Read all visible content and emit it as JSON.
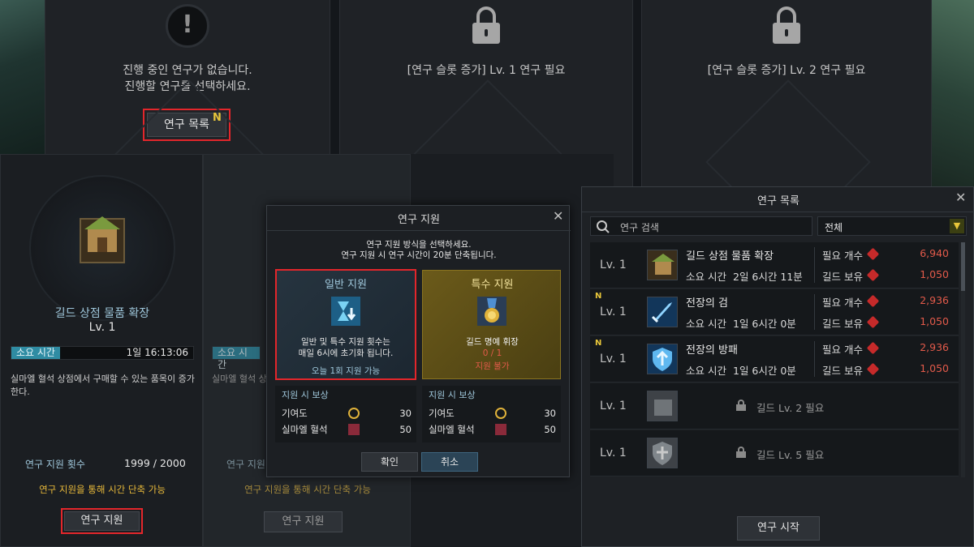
{
  "top_slots": {
    "slot1": {
      "line1": "진행 중인 연구가 없습니다.",
      "line2": "진행할 연구를 선택하세요.",
      "button": "연구 목록",
      "badge": "N"
    },
    "slot2": {
      "text": "[연구 슬롯 증가] Lv. 1 연구 필요"
    },
    "slot3": {
      "text": "[연구 슬롯 증가] Lv. 2 연구 필요"
    }
  },
  "research_panel": {
    "name": "길드 상점 물품 확장",
    "level": "Lv. 1",
    "time_label": "소요 시간",
    "time_value": "1일 16:13:06",
    "description": "실마엘 혈석 상점에서 구매할 수 있는 품목이 증가한다.",
    "support_count_label": "연구 지원 횟수",
    "support_count_value": "1999 / 2000",
    "notice": "연구 지원을 통해 시간 단축 가능",
    "button": "연구 지원"
  },
  "ghost_panel": {
    "time_label": "소요 시간",
    "description_fragment": "실마엘 혈석 상점",
    "support_count_label": "연구 지원 횟수",
    "notice": "연구 지원을 통해 시간 단축 가능",
    "button": "연구 지원"
  },
  "support_dialog": {
    "title": "연구 지원",
    "intro1": "연구 지원 방식을 선택하세요.",
    "intro2": "연구 지원 시 연구 시간이 20분 단축됩니다.",
    "normal": {
      "title": "일반 지원",
      "desc1": "일반 및 특수 지원 횟수는",
      "desc2": "매일 6시에 초기화 됩니다.",
      "available": "오늘 1회 지원 가능"
    },
    "special": {
      "title": "특수 지원",
      "item": "길드 명예 휘장",
      "count": "0 / 1",
      "status": "지원 불가"
    },
    "reward_header": "지원 시 보상",
    "rewards_normal": [
      {
        "label": "기여도",
        "value": "30"
      },
      {
        "label": "실마엘 혈석",
        "value": "50"
      }
    ],
    "rewards_special": [
      {
        "label": "기여도",
        "value": "30"
      },
      {
        "label": "실마엘 혈석",
        "value": "50"
      }
    ],
    "confirm": "확인",
    "cancel": "취소"
  },
  "research_list": {
    "title": "연구 목록",
    "search_placeholder": "연구 검색",
    "filter": "전체",
    "req_label": "필요 개수",
    "own_label": "길드 보유",
    "time_label": "소요 시간",
    "rows": [
      {
        "new": "",
        "lv": "Lv. 1",
        "name": "길드 상점 물품 확장",
        "time": "2일 6시간 11분",
        "req": "6,940",
        "own": "1,050"
      },
      {
        "new": "N",
        "lv": "Lv. 1",
        "name": "전장의 검",
        "time": "1일 6시간 0분",
        "req": "2,936",
        "own": "1,050"
      },
      {
        "new": "N",
        "lv": "Lv. 1",
        "name": "전장의 방패",
        "time": "1일 6시간 0분",
        "req": "2,936",
        "own": "1,050"
      },
      {
        "new": "",
        "lv": "Lv. 1",
        "locked": "길드 Lv. 2 필요"
      },
      {
        "new": "",
        "lv": "Lv. 1",
        "locked": "길드 Lv. 5 필요"
      }
    ],
    "start_button": "연구 시작"
  },
  "colors": {
    "highlight_red": "#e3262b",
    "cost_red": "#e25a4a",
    "notice_yellow": "#e8b93a",
    "time_label_teal": "#2f8ca3"
  }
}
